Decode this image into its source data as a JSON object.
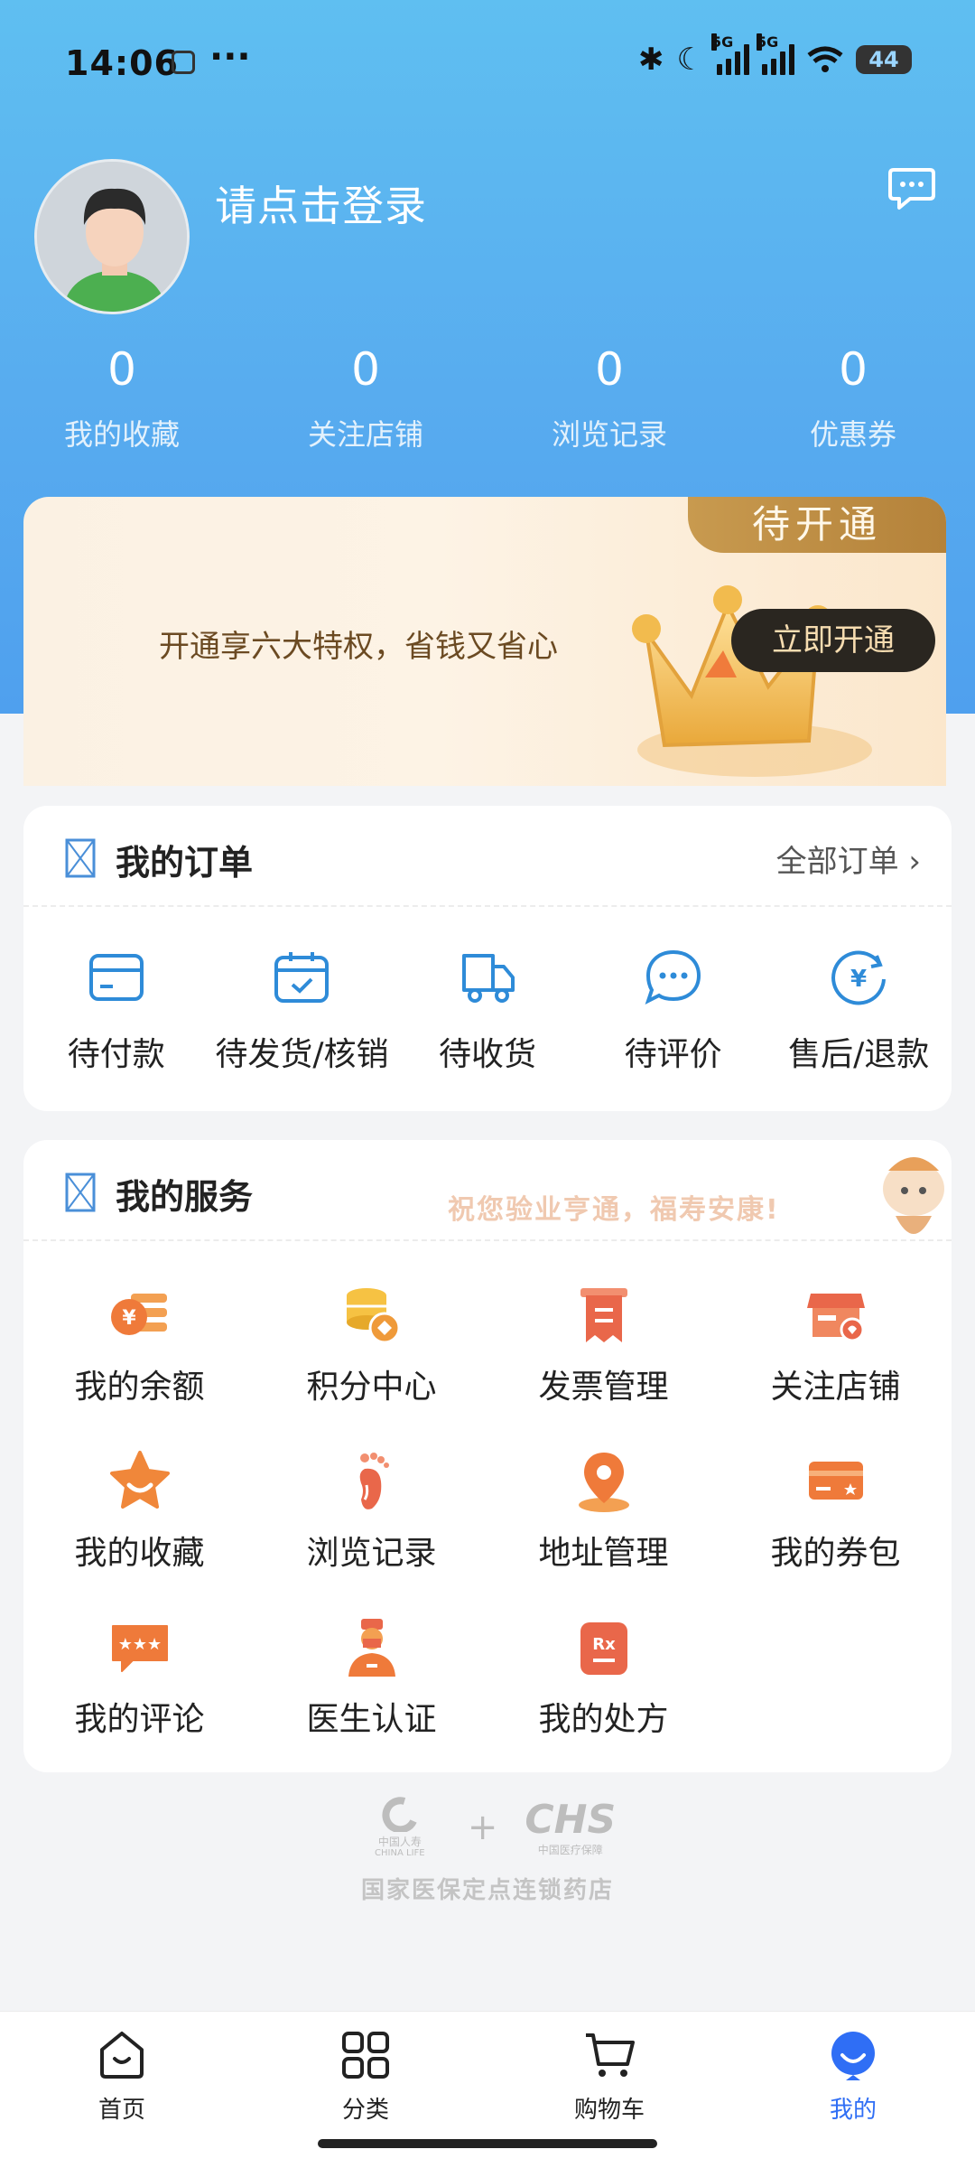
{
  "status_bar": {
    "time": "14:06",
    "more": "···",
    "network_1": "5G",
    "network_2": "5G",
    "battery": "44"
  },
  "profile": {
    "login_prompt": "请点击登录"
  },
  "stats": [
    {
      "value": "0",
      "label": "我的收藏"
    },
    {
      "value": "0",
      "label": "关注店铺"
    },
    {
      "value": "0",
      "label": "浏览记录"
    },
    {
      "value": "0",
      "label": "优惠券"
    }
  ],
  "vip": {
    "tag": "待开通",
    "text": "开通享六大特权，省钱又省心",
    "button": "立即开通"
  },
  "orders": {
    "title": "我的订单",
    "all_link": "全部订单",
    "items": [
      {
        "label": "待付款",
        "icon": "wallet-icon"
      },
      {
        "label": "待发货/核销",
        "icon": "calendar-check-icon"
      },
      {
        "label": "待收货",
        "icon": "truck-icon"
      },
      {
        "label": "待评价",
        "icon": "chat-bubble-icon"
      },
      {
        "label": "售后/退款",
        "icon": "refund-icon"
      }
    ]
  },
  "services": {
    "title": "我的服务",
    "slogan": "祝您验业亨通，福寿安康!",
    "items": [
      {
        "label": "我的余额",
        "icon": "coin-balance-icon"
      },
      {
        "label": "积分中心",
        "icon": "points-coins-icon"
      },
      {
        "label": "发票管理",
        "icon": "invoice-icon"
      },
      {
        "label": "关注店铺",
        "icon": "store-icon"
      },
      {
        "label": "我的收藏",
        "icon": "star-icon"
      },
      {
        "label": "浏览记录",
        "icon": "footprint-icon"
      },
      {
        "label": "地址管理",
        "icon": "location-pin-icon"
      },
      {
        "label": "我的券包",
        "icon": "coupon-card-icon"
      },
      {
        "label": "我的评论",
        "icon": "comment-stars-icon"
      },
      {
        "label": "医生认证",
        "icon": "doctor-icon"
      },
      {
        "label": "我的处方",
        "icon": "prescription-icon"
      }
    ]
  },
  "footer": {
    "caption": "国家医保定点连锁药店",
    "logo_left_cn": "中国人寿",
    "logo_left_en": "CHINA LIFE",
    "logo_plus": "+",
    "logo_right": "CHS",
    "logo_right_cn": "中国医疗保障"
  },
  "tabbar": [
    {
      "label": "首页",
      "icon": "home-icon"
    },
    {
      "label": "分类",
      "icon": "grid-icon"
    },
    {
      "label": "购物车",
      "icon": "cart-icon"
    },
    {
      "label": "我的",
      "icon": "profile-icon",
      "active": true
    }
  ],
  "colors": {
    "header_gradient_top": "#5fbff1",
    "accent_blue": "#2f6ef5",
    "vip_gold": "#c89a4f",
    "service_orange": "#ef7a3a",
    "order_icon_blue": "#2e8bd8"
  }
}
